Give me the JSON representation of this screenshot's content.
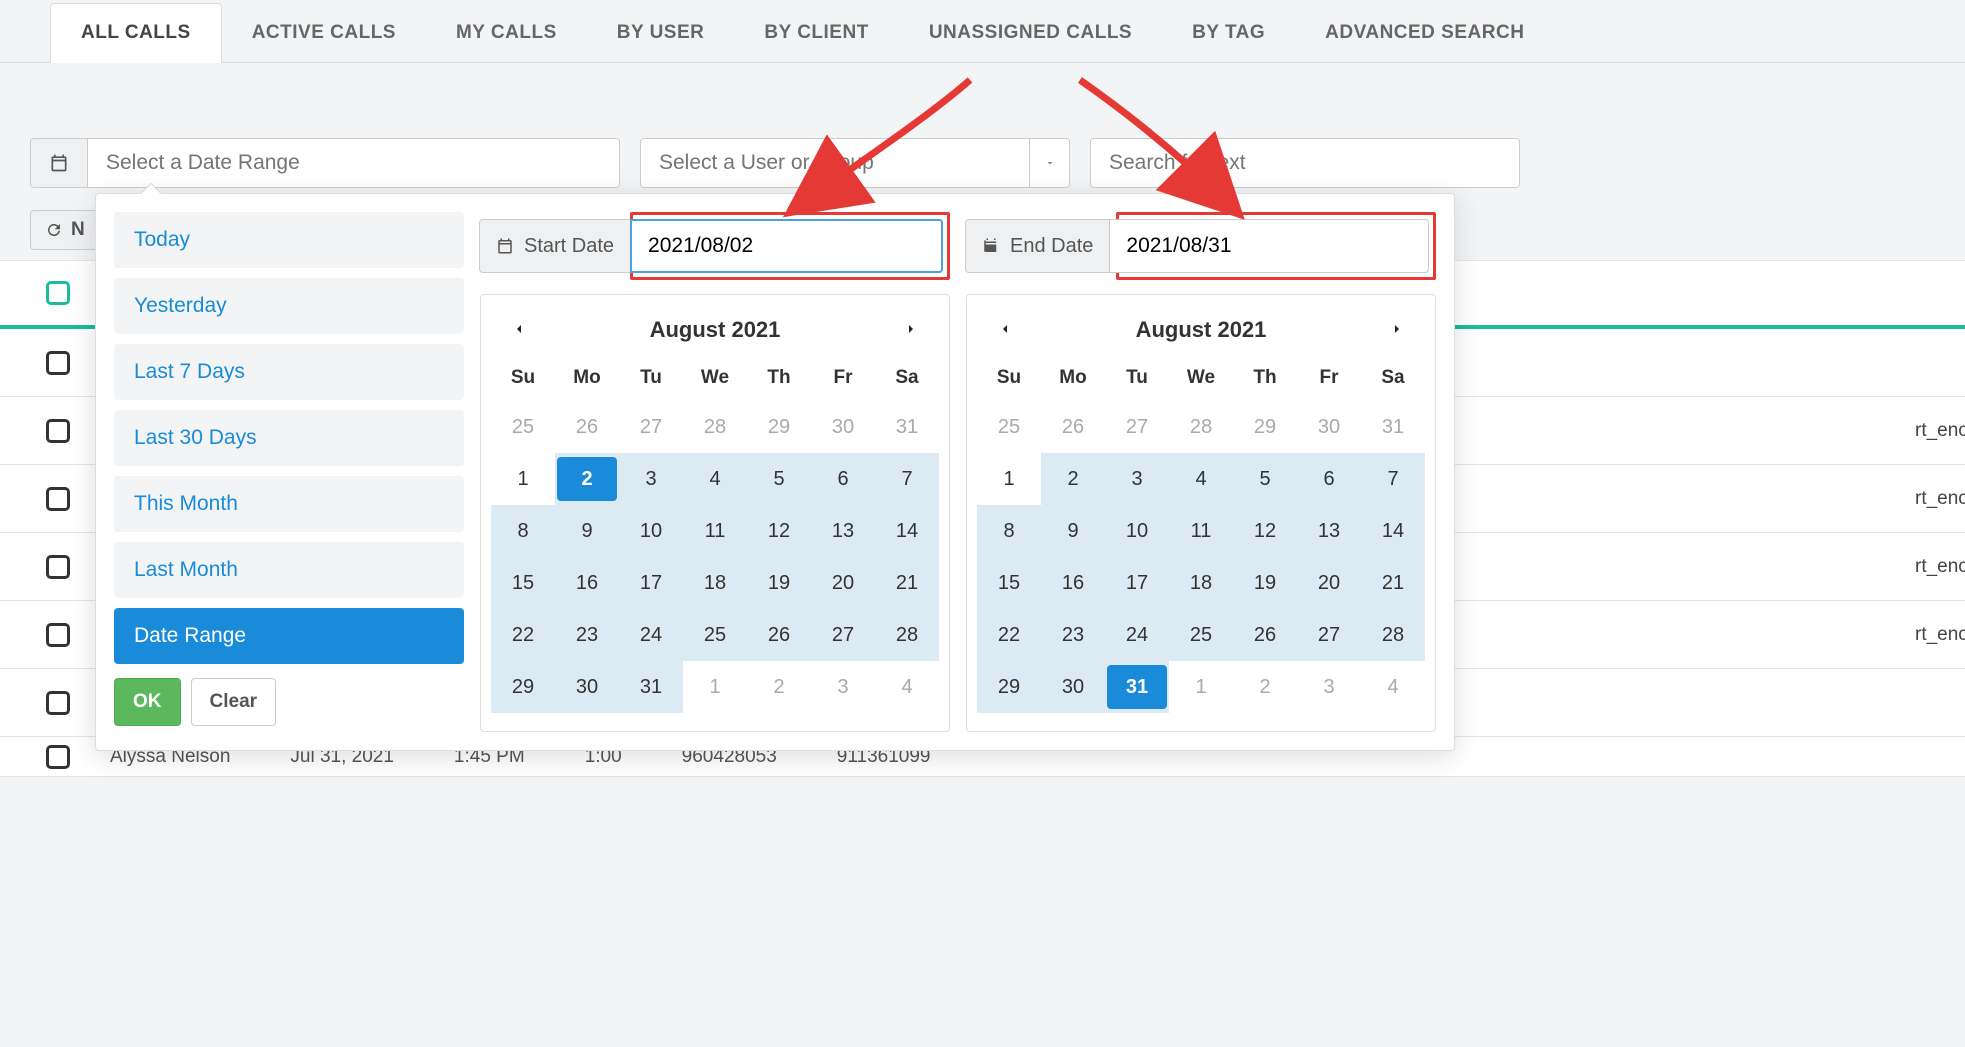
{
  "tabs": [
    "ALL CALLS",
    "ACTIVE CALLS",
    "MY CALLS",
    "BY USER",
    "BY CLIENT",
    "UNASSIGNED CALLS",
    "BY TAG",
    "ADVANCED SEARCH"
  ],
  "active_tab_index": 0,
  "filters": {
    "date_range_placeholder": "Select a Date Range",
    "user_group_placeholder": "Select a User or Group",
    "search_placeholder": "Search for text"
  },
  "refresh_button_label": "N",
  "presets": [
    "Today",
    "Yesterday",
    "Last 7 Days",
    "Last 30 Days",
    "This Month",
    "Last Month",
    "Date Range"
  ],
  "preset_active_index": 6,
  "preset_ok": "OK",
  "preset_clear": "Clear",
  "start_date": {
    "label": "Start Date",
    "value": "2021/08/02"
  },
  "end_date": {
    "label": "End Date",
    "value": "2021/08/31"
  },
  "calendar_title": "August 2021",
  "weekdays": [
    "Su",
    "Mo",
    "Tu",
    "We",
    "Th",
    "Fr",
    "Sa"
  ],
  "cal_start": {
    "prev_tail": [
      25,
      26,
      27,
      28,
      29,
      30,
      31
    ],
    "days": [
      1,
      2,
      3,
      4,
      5,
      6,
      7,
      8,
      9,
      10,
      11,
      12,
      13,
      14,
      15,
      16,
      17,
      18,
      19,
      20,
      21,
      22,
      23,
      24,
      25,
      26,
      27,
      28,
      29,
      30,
      31
    ],
    "next_head": [
      1,
      2,
      3,
      4
    ],
    "selected_day": 2,
    "range_start": 2,
    "range_end": 31
  },
  "cal_end": {
    "prev_tail": [
      25,
      26,
      27,
      28,
      29,
      30,
      31
    ],
    "days": [
      1,
      2,
      3,
      4,
      5,
      6,
      7,
      8,
      9,
      10,
      11,
      12,
      13,
      14,
      15,
      16,
      17,
      18,
      19,
      20,
      21,
      22,
      23,
      24,
      25,
      26,
      27,
      28,
      29,
      30,
      31
    ],
    "next_head": [
      1,
      2,
      3,
      4
    ],
    "selected_day": 31,
    "range_start": 2,
    "range_end": 31
  },
  "visible_row": {
    "name": "Alyssa Nelson",
    "date": "Jul 31, 2021",
    "time": "1:45 PM",
    "duration": "1:00",
    "num1": "960428053",
    "num2": "911361099"
  },
  "right_edge_tags": [
    "rt_encry",
    "rt_encry",
    "rt_encry",
    "rt_encry"
  ]
}
